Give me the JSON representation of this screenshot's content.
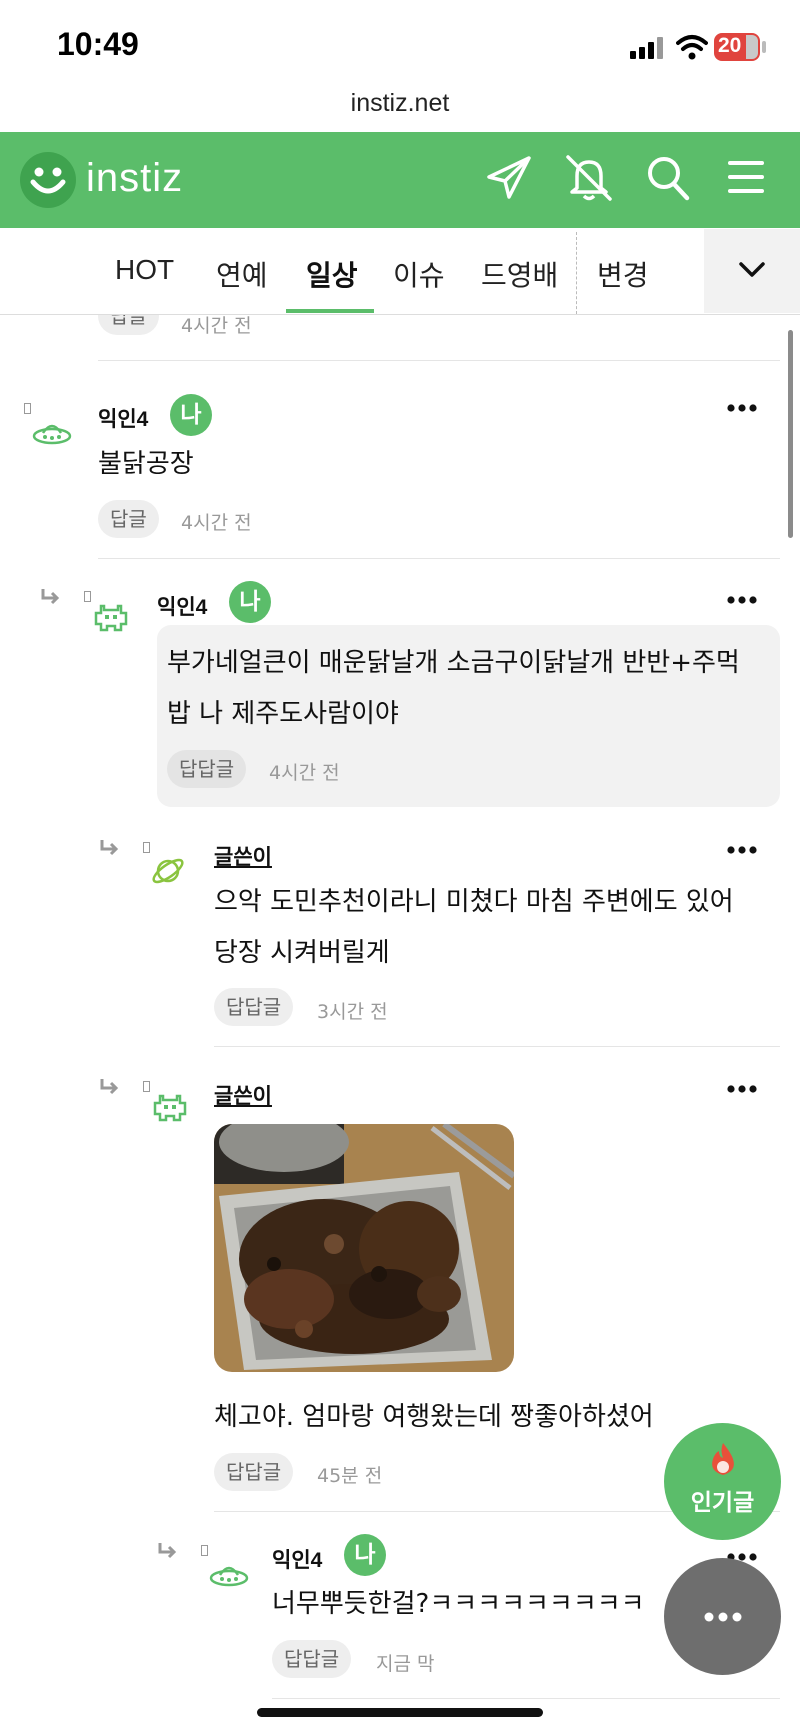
{
  "status_bar": {
    "time": "10:49",
    "battery": "20"
  },
  "browser": {
    "url": "instiz.net"
  },
  "header": {
    "logo_text": "instiz",
    "accent_color": "#5bbd6a",
    "icons": [
      "paper-plane-icon",
      "bell-off-icon",
      "search-icon",
      "menu-icon"
    ]
  },
  "nav": {
    "items": [
      "HOT",
      "연예",
      "일상",
      "이슈",
      "드영배",
      "변경"
    ],
    "active": "일상"
  },
  "comments": [
    {
      "reply_label": "답글",
      "time": "4시간 전"
    },
    {
      "nickname": "익인4",
      "badge": "나",
      "text": "불닭공장",
      "reply_label": "답글",
      "time": "4시간 전"
    },
    {
      "nickname": "익인4",
      "badge": "나",
      "text_line1": "부가네얼큰이 매운닭날개 소금구이닭날개 반반+주먹",
      "text_line2": "밥 나 제주도사람이야",
      "reply_label": "답답글",
      "time": "4시간 전"
    },
    {
      "nickname": "글쓴이",
      "text_line1": "으악 도민추천이라니 미쳤다 마침 주변에도 있어",
      "text_line2": "당장 시켜버릴게",
      "reply_label": "답답글",
      "time": "3시간 전"
    },
    {
      "nickname": "글쓴이",
      "text": "체고야. 엄마랑 여행왔는데 짱좋아하셨어",
      "reply_label": "답답글",
      "time": "45분 전"
    },
    {
      "nickname": "익인4",
      "badge": "나",
      "text": "너무뿌듯한걸?ㅋㅋㅋㅋㅋㅋㅋㅋㅋ",
      "reply_label": "답답글",
      "time": "지금 막"
    }
  ],
  "fab": {
    "popular_label": "인기글"
  }
}
